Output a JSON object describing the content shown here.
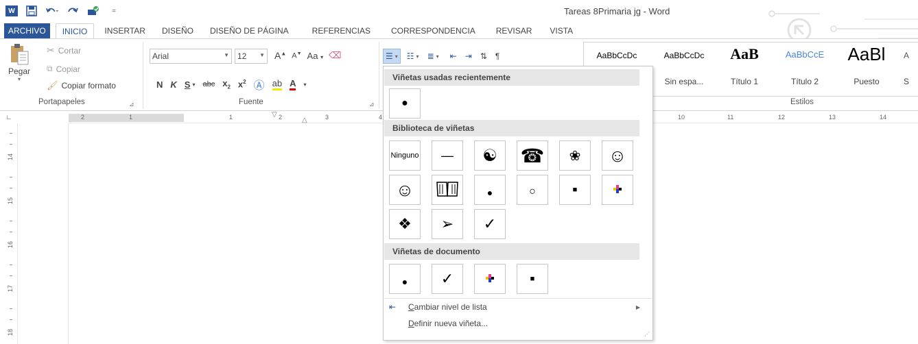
{
  "window": {
    "title": "Tareas 8Primaria jg - Word"
  },
  "qat": {
    "app_icon": "word-icon",
    "app_letter": "W",
    "save_icon": "save-icon",
    "undo_icon": "undo-icon",
    "redo_icon": "redo-icon",
    "touch_icon": "touch-mode-icon",
    "customize_icon": "customize-qat-icon"
  },
  "tabs": [
    {
      "label": "ARCHIVO"
    },
    {
      "label": "INICIO"
    },
    {
      "label": "INSERTAR"
    },
    {
      "label": "DISEÑO"
    },
    {
      "label": "DISEÑO DE PÁGINA"
    },
    {
      "label": "REFERENCIAS"
    },
    {
      "label": "CORRESPONDENCIA"
    },
    {
      "label": "REVISAR"
    },
    {
      "label": "VISTA"
    }
  ],
  "clipboard": {
    "paste": "Pegar",
    "cut": "Cortar",
    "copy": "Copiar",
    "format_painter": "Copiar formato",
    "group_label": "Portapapeles"
  },
  "font": {
    "name": "Arial",
    "size": "12",
    "case_label": "Aa",
    "bold": "N",
    "italic": "K",
    "underline": "S",
    "strike": "abc",
    "subscript": "x",
    "sub_mark": "2",
    "superscript": "x",
    "sup_mark": "2",
    "group_label": "Fuente"
  },
  "styles": {
    "group_label": "Estilos",
    "items": [
      {
        "sample": "AaBbCcDc",
        "name": ""
      },
      {
        "sample": "AaBbCcDc",
        "name": "Sin espa..."
      },
      {
        "sample": "AaB",
        "name": "Título 1"
      },
      {
        "sample": "AaBbCcE",
        "name": "Título 2"
      },
      {
        "sample": "AaBl",
        "name": "Puesto"
      },
      {
        "sample": "A",
        "name": "S"
      }
    ]
  },
  "ruler": {
    "h_numbers": [
      "2",
      "1",
      "1",
      "2",
      "3",
      "4",
      "10",
      "11",
      "12",
      "13",
      "14"
    ],
    "v_numbers": [
      "14",
      "15",
      "16",
      "17",
      "18"
    ]
  },
  "bullets_menu": {
    "recent_header": "Viñetas usadas recientemente",
    "library_header": "Biblioteca de viñetas",
    "document_header": "Viñetas de documento",
    "none_label": "Ninguno",
    "library_glyphs": [
      "—",
      "☯",
      "☎",
      "❀",
      "☺",
      "☺",
      "📖",
      "●",
      "○",
      "■",
      "✚",
      "❖",
      "➢",
      "✓"
    ],
    "recent_glyphs": [
      "●"
    ],
    "document_glyphs": [
      "●",
      "✓",
      "✚",
      "■"
    ],
    "change_level": "Cambiar nivel de lista",
    "change_level_accel": "C",
    "change_level_rest": "ambiar nivel de lista",
    "define_new": "Definir nueva viñeta...",
    "define_accel": "D",
    "define_rest": "efinir nueva viñeta..."
  },
  "colors": {
    "accent": "#2b579a",
    "pressed": "#c5daf2",
    "section_bg": "#e6e6e6"
  }
}
